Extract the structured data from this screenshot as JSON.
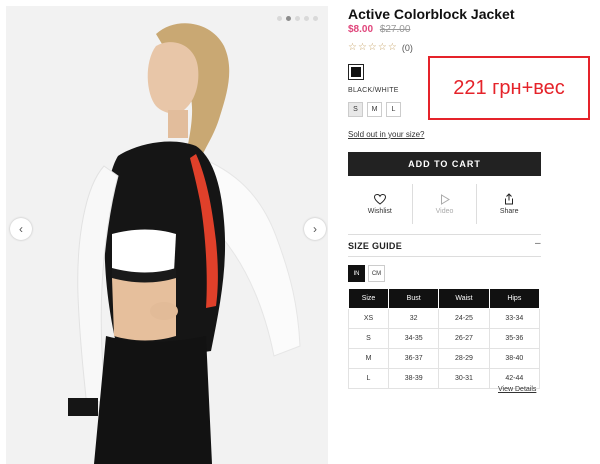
{
  "product": {
    "title": "Active Colorblock Jacket",
    "price": "$8.00",
    "old_price": "$27.00",
    "rating_stars": "☆☆☆☆☆",
    "review_count": "(0)",
    "color_name": "BLACK/WHITE",
    "sizes": [
      "S",
      "M",
      "L"
    ],
    "selected_size": "S",
    "sold_out_link": "Sold out in your size?",
    "add_to_cart": "ADD TO CART"
  },
  "actions": {
    "wishlist": "Wishlist",
    "video": "Video",
    "share": "Share"
  },
  "size_guide": {
    "title": "SIZE GUIDE",
    "toggle": "–",
    "units": [
      "IN",
      "CM"
    ],
    "selected_unit": "IN",
    "headers": [
      "Size",
      "Bust",
      "Waist",
      "Hips"
    ],
    "rows": [
      [
        "XS",
        "32",
        "24-25",
        "33-34"
      ],
      [
        "S",
        "34-35",
        "26-27",
        "35-36"
      ],
      [
        "M",
        "36-37",
        "28-29",
        "38-40"
      ],
      [
        "L",
        "38-39",
        "30-31",
        "42-44"
      ]
    ],
    "view_details": "View Details"
  },
  "annotation": "221 грн+вес",
  "colors": {
    "accent_price": "#e0457b",
    "annotation_red": "#e5232a",
    "button_dark": "#222222"
  }
}
